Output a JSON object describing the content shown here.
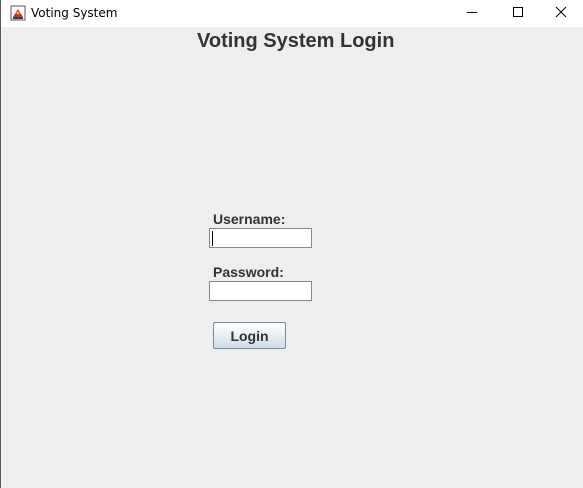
{
  "window": {
    "title": "Voting System",
    "icons": {
      "app": "java-app-icon",
      "minimize": "minimize-icon",
      "maximize": "maximize-icon",
      "close": "close-icon"
    }
  },
  "form": {
    "heading": "Voting System Login",
    "username_label": "Username:",
    "username_value": "",
    "password_label": "Password:",
    "password_value": "",
    "login_label": "Login"
  },
  "colors": {
    "background": "#eeeeee",
    "text": "#333333",
    "field_border": "#7a8a99"
  }
}
